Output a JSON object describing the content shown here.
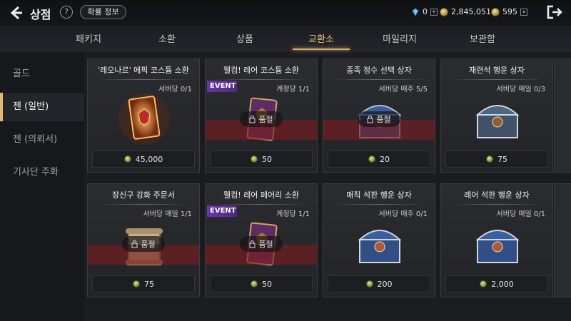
{
  "header": {
    "title": "상점",
    "help_label": "?",
    "prob_button": "확률 정보",
    "diamond_amount": "0",
    "diamond_plus": "+",
    "coin_amount": "2,845,051",
    "gem_amount": "595",
    "gem_dropdown": "▾"
  },
  "tabs": [
    "패키지",
    "소환",
    "상품",
    "교환소",
    "마일리지",
    "보관함"
  ],
  "active_tab": "교환소",
  "sidebar": [
    "골드",
    "젠 (일반)",
    "젠 (의뢰서)",
    "기사단 주화"
  ],
  "active_sidebar": "젠 (일반)",
  "cards": [
    {
      "title": "'레오나르' 에픽 코스튬 소환",
      "limit": "서버당 0/1",
      "price": "45,000",
      "event": "",
      "soldout": "",
      "art": "card-gold"
    },
    {
      "title": "웰컴! 레어 코스튬 소환",
      "limit": "계정당 1/1",
      "price": "50",
      "event": "EVENT",
      "soldout": "품절",
      "art": "card-purple"
    },
    {
      "title": "종족 정수 선택 상자",
      "limit": "서버당 매주 5/5",
      "price": "20",
      "event": "",
      "soldout": "품절",
      "art": "chest-blue"
    },
    {
      "title": "재련석 행운 상자",
      "limit": "서버당 매일 0/3",
      "price": "75",
      "event": "",
      "soldout": "",
      "art": "chest-silver"
    },
    {
      "title": "장신구 강화 주문서",
      "limit": "서버당 매일 1/1",
      "price": "75",
      "event": "",
      "soldout": "품절",
      "art": "scroll"
    },
    {
      "title": "웰컴! 레어 페어리 소환",
      "limit": "계정당 1/1",
      "price": "50",
      "event": "EVENT",
      "soldout": "품절",
      "art": "card-purple"
    },
    {
      "title": "매직 석판 행운 상자",
      "limit": "서버당 매주 0/1",
      "price": "200",
      "event": "",
      "soldout": "",
      "art": "chest-blue"
    },
    {
      "title": "레어 석판 행운 상자",
      "limit": "서버당 매일 0/1",
      "price": "2,000",
      "event": "",
      "soldout": "",
      "art": "chest-blue"
    }
  ],
  "colors": {
    "accent": "#e2b86a",
    "event": "#6a36a8",
    "soldout": "#781c20"
  }
}
